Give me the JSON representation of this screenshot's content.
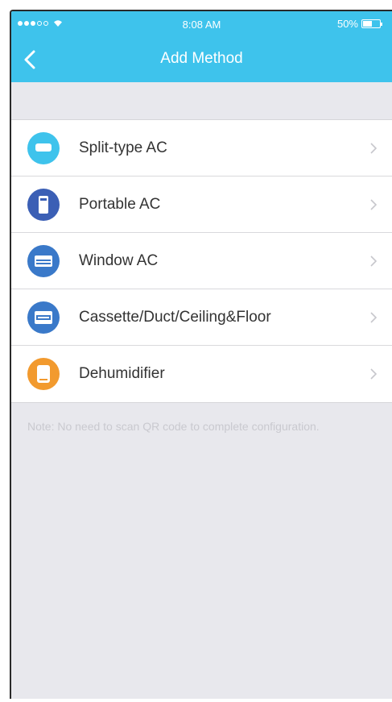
{
  "status_bar": {
    "time": "8:08 AM",
    "battery": "50%"
  },
  "nav": {
    "title": "Add Method",
    "back_icon": "chevron-left-icon"
  },
  "colors": {
    "accent": "#3ec3ec",
    "background": "#e8e8ed"
  },
  "methods": [
    {
      "label": "Split-type AC",
      "icon": "split-ac-icon",
      "color": "#3ec3ec"
    },
    {
      "label": "Portable AC",
      "icon": "portable-ac-icon",
      "color": "#3b5fb5"
    },
    {
      "label": "Window AC",
      "icon": "window-ac-icon",
      "color": "#3a79c9"
    },
    {
      "label": "Cassette/Duct/Ceiling&Floor",
      "icon": "cassette-ac-icon",
      "color": "#3a79c9"
    },
    {
      "label": "Dehumidifier",
      "icon": "dehumidifier-icon",
      "color": "#f29a2e"
    }
  ],
  "note": "Note: No need to scan QR code to complete configuration."
}
